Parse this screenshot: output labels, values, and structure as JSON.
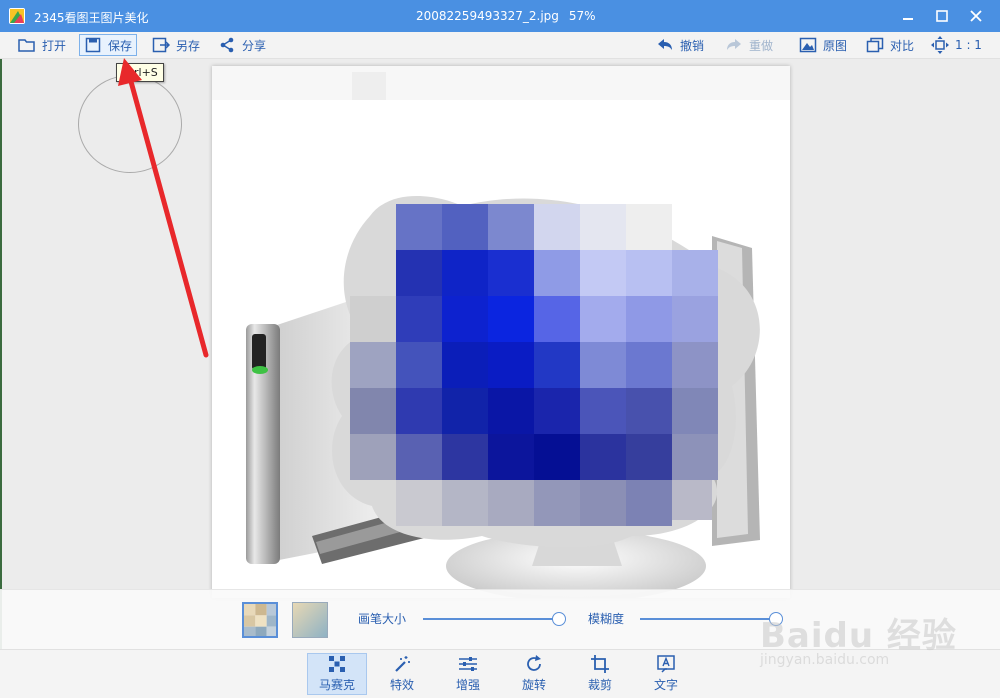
{
  "titlebar": {
    "app_name": "2345看图王图片美化",
    "file_name": "20082259493327_2.jpg",
    "zoom": "57%"
  },
  "toolbar": {
    "open_label": "打开",
    "save_label": "保存",
    "save_as_label": "另存",
    "share_label": "分享",
    "undo_label": "撤销",
    "redo_label": "重做",
    "original_label": "原图",
    "compare_label": "对比",
    "one_to_one_label": "1 : 1"
  },
  "tooltip": "Ctrl+S",
  "mosaic_panel": {
    "brush_size_label": "画笔大小",
    "blur_label": "模糊度",
    "brush_size_value": 0.85,
    "blur_value": 1.0
  },
  "bottom_tabs": [
    {
      "label": "马赛克",
      "icon": "mosaic-icon"
    },
    {
      "label": "特效",
      "icon": "magic-wand-icon"
    },
    {
      "label": "增强",
      "icon": "sliders-icon"
    },
    {
      "label": "旋转",
      "icon": "rotate-icon"
    },
    {
      "label": "裁剪",
      "icon": "crop-icon"
    },
    {
      "label": "文字",
      "icon": "text-icon"
    }
  ],
  "watermark": {
    "logo": "Baidu 经验",
    "url": "jingyan.baidu.com"
  },
  "colors": {
    "titlebar": "#4a90e2",
    "accent": "#2a5fb0",
    "arrow": "#e8282b"
  }
}
